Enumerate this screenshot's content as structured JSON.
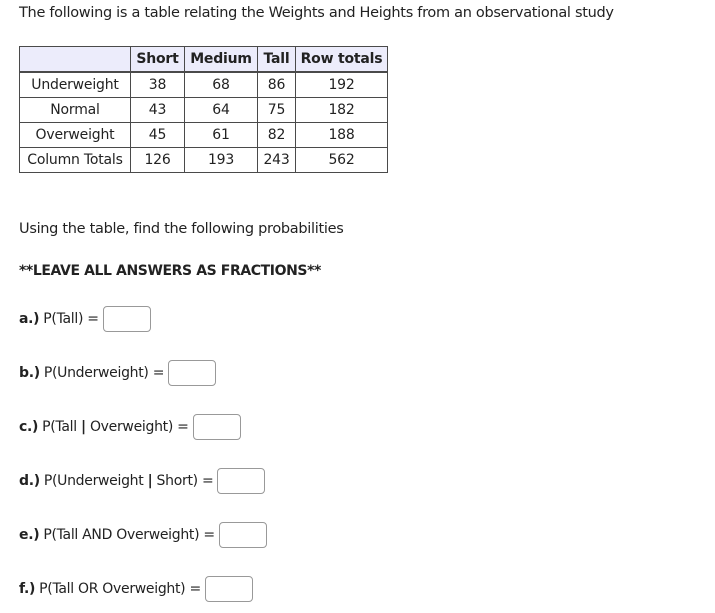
{
  "intro": "The following is a table relating the Weights and Heights from an observational study",
  "table": {
    "headers": [
      "",
      "Short",
      "Medium",
      "Tall",
      "Row totals"
    ],
    "rows": [
      [
        "Underweight",
        "38",
        "68",
        "86",
        "192"
      ],
      [
        "Normal",
        "43",
        "64",
        "75",
        "182"
      ],
      [
        "Overweight",
        "45",
        "61",
        "82",
        "188"
      ],
      [
        "Column Totals",
        "126",
        "193",
        "243",
        "562"
      ]
    ]
  },
  "instructions": "Using the table, find the following probabilities",
  "note": "**LEAVE ALL ANSWERS AS FRACTIONS**",
  "questions": [
    {
      "label": "a.)",
      "pre": "P(Tall) =",
      "bar": "",
      "post": "",
      "value": ""
    },
    {
      "label": "b.)",
      "pre": "P(Underweight) =",
      "bar": "",
      "post": "",
      "value": ""
    },
    {
      "label": "c.)",
      "pre": "P(Tall ",
      "bar": "|",
      "post": " Overweight) =",
      "value": ""
    },
    {
      "label": "d.)",
      "pre": "P(Underweight ",
      "bar": "|",
      "post": " Short) =",
      "value": ""
    },
    {
      "label": "e.)",
      "pre": "P(Tall AND Overweight) =",
      "bar": "",
      "post": "",
      "value": ""
    },
    {
      "label": "f.)",
      "pre": "P(Tall OR Overweight) =",
      "bar": "",
      "post": "",
      "value": ""
    }
  ]
}
